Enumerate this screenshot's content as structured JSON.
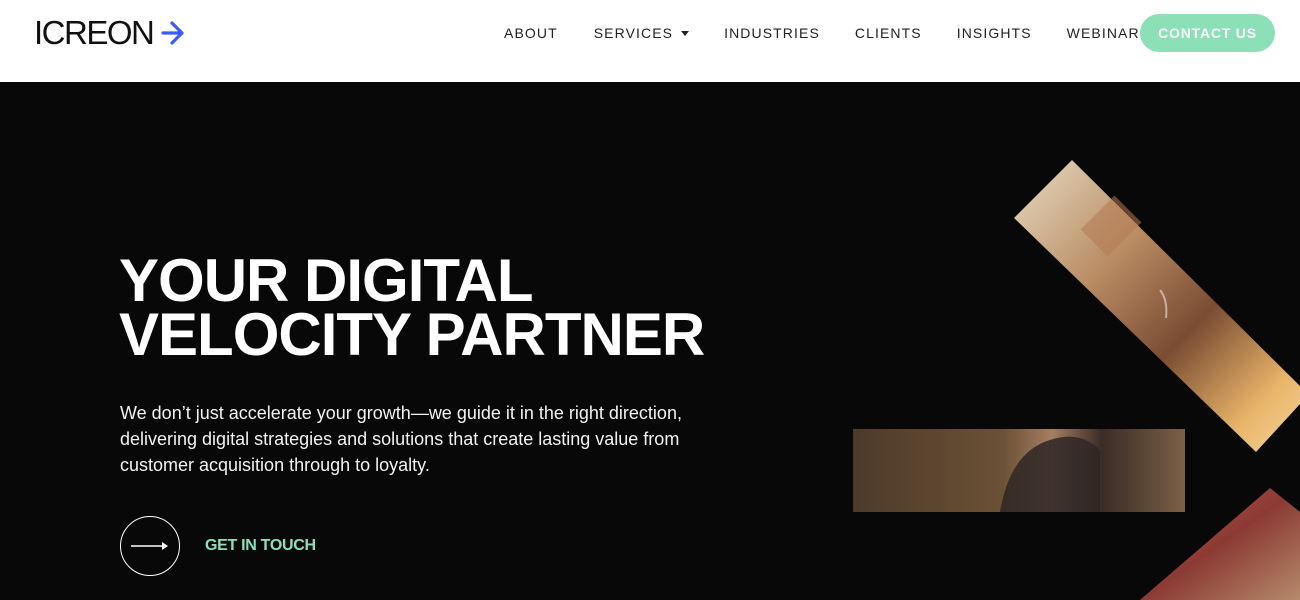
{
  "brand": {
    "name": "ICREON",
    "logo_icon": "arrow-right-icon",
    "accent_color": "#3d5afe",
    "cta_color": "#8ce0b8"
  },
  "nav": {
    "items": [
      {
        "label": "ABOUT"
      },
      {
        "label": "SERVICES",
        "has_dropdown": true
      },
      {
        "label": "INDUSTRIES"
      },
      {
        "label": "CLIENTS"
      },
      {
        "label": "INSIGHTS"
      },
      {
        "label": "WEBINARS"
      }
    ],
    "cta_label": "CONTACT US"
  },
  "hero": {
    "title_lines": [
      "YOUR DIGITAL",
      "VELOCITY PARTNER"
    ],
    "description_lines": [
      "We don’t just accelerate your growth—we guide it in the right direction,",
      "delivering digital strategies and solutions that create lasting value from",
      "customer acquisition through to loyalty."
    ],
    "cta_label": "GET IN TOUCH",
    "cta_icon": "arrow-right-icon"
  }
}
